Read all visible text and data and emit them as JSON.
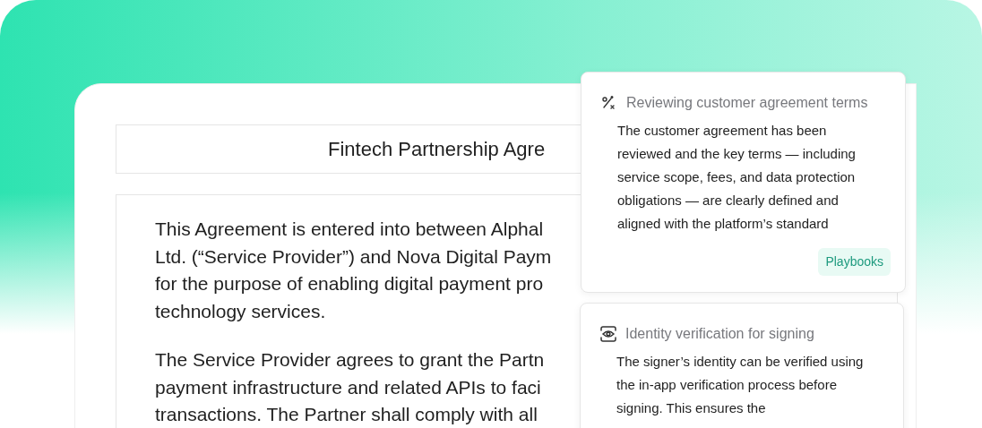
{
  "document": {
    "title": "Fintech Partnership Agre",
    "paragraphs": [
      [
        "This Agreement is entered into between Alphal",
        "Ltd. (“Service Provider”) and Nova Digital Paym",
        "for the purpose of enabling digital payment pro",
        "technology services."
      ],
      [
        "The Service Provider agrees to grant the Partn",
        "payment infrastructure and related APIs to faci",
        "transactions. The Partner shall comply with all"
      ]
    ]
  },
  "cards": [
    {
      "kind": "review",
      "title": "Reviewing customer agreement terms",
      "body": "The customer agreement has been reviewed and the key terms — including service scope, fees, and data protection obligations — are clearly defined and aligned with the platform’s standard",
      "tag": "Playbooks"
    },
    {
      "kind": "identity",
      "title": "Identity verification for signing",
      "body": "The signer’s identity can be verified using the in-app verification process before signing. This ensures the"
    }
  ]
}
